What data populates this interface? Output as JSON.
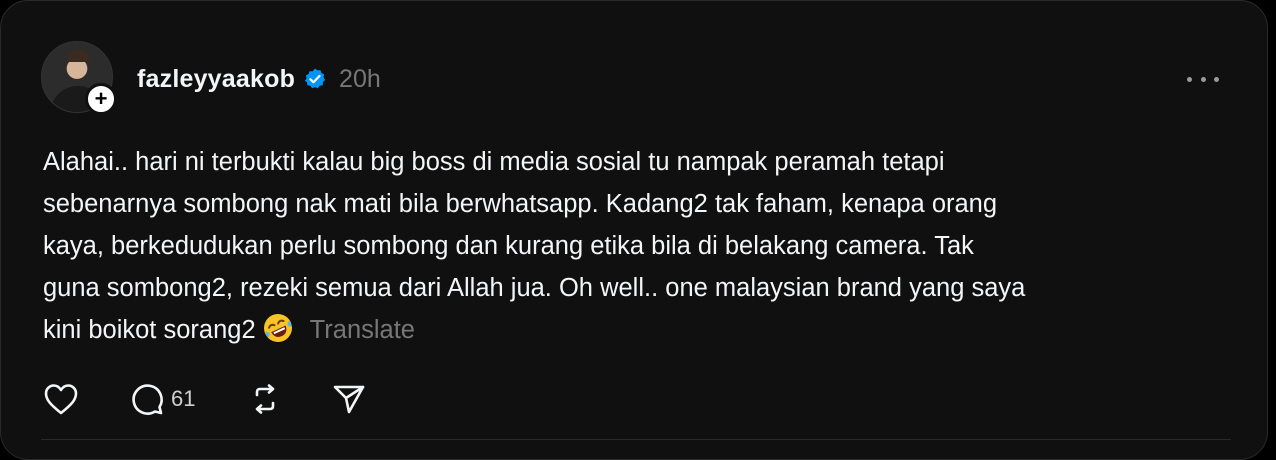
{
  "post": {
    "username": "fazleyyaakob",
    "verified_icon": "verified-badge-icon",
    "timestamp": "20h",
    "text_lines": [
      "Alahai.. hari ni terbukti kalau big boss di media sosial tu nampak peramah tetapi",
      "sebenarnya sombong nak mati bila berwhatsapp. Kadang2 tak faham, kenapa orang",
      "kaya, berkedudukan perlu sombong dan kurang etika bila di belakang camera. Tak",
      "guna sombong2, rezeki semua dari Allah jua. Oh well.. one malaysian brand yang saya",
      "kini boikot sorang2"
    ],
    "emoji": "rolling-on-floor-laughing-emoji",
    "translate_label": "Translate",
    "reply_count": "61"
  },
  "colors": {
    "background": "#101010",
    "text": "#f3f5f7",
    "muted": "#777777",
    "verified": "#0095f6"
  }
}
